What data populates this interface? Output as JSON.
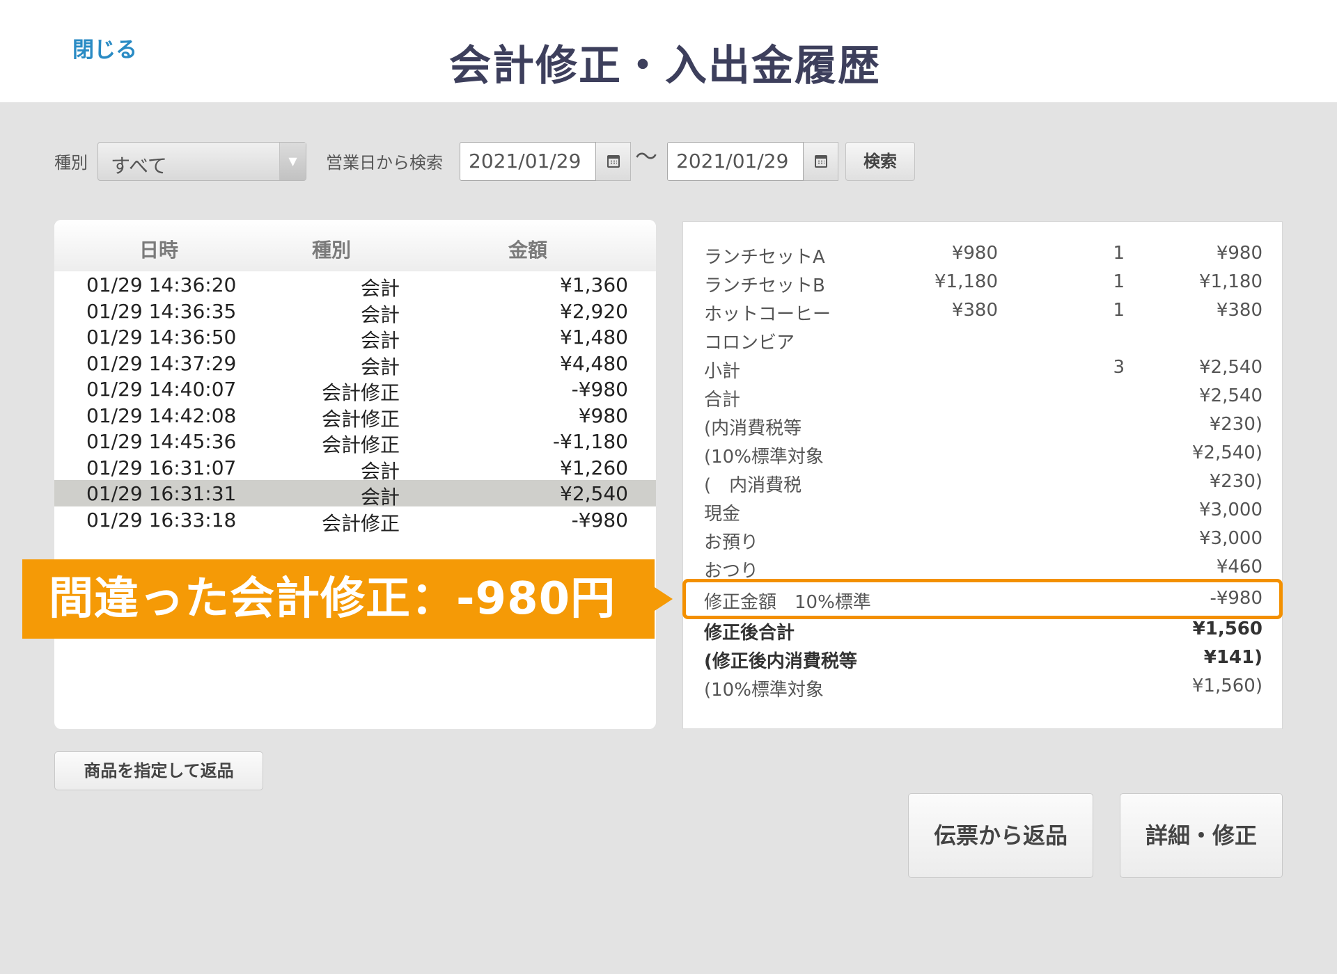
{
  "header": {
    "close_label": "閉じる",
    "title": "会計修正・入出金履歴"
  },
  "filter": {
    "type_label": "種別",
    "type_value": "すべて",
    "date_label": "営業日から検索",
    "date_from": "2021/01/29",
    "tilde": "〜",
    "date_to": "2021/01/29",
    "search_label": "検索"
  },
  "list": {
    "columns": [
      "日時",
      "種別",
      "金額"
    ],
    "rows": [
      {
        "datetime": "01/29 14:36:20",
        "type": "会計",
        "amount": "¥1,360"
      },
      {
        "datetime": "01/29 14:36:35",
        "type": "会計",
        "amount": "¥2,920"
      },
      {
        "datetime": "01/29 14:36:50",
        "type": "会計",
        "amount": "¥1,480"
      },
      {
        "datetime": "01/29 14:37:29",
        "type": "会計",
        "amount": "¥4,480"
      },
      {
        "datetime": "01/29 14:40:07",
        "type": "会計修正",
        "amount": "-¥980"
      },
      {
        "datetime": "01/29 14:42:08",
        "type": "会計修正",
        "amount": "¥980"
      },
      {
        "datetime": "01/29 14:45:36",
        "type": "会計修正",
        "amount": "-¥1,180"
      },
      {
        "datetime": "01/29 16:31:07",
        "type": "会計",
        "amount": "¥1,260"
      },
      {
        "datetime": "01/29 16:31:31",
        "type": "会計",
        "amount": "¥2,540"
      },
      {
        "datetime": "01/29 16:33:18",
        "type": "会計修正",
        "amount": "-¥980"
      }
    ],
    "selected_index": 8
  },
  "detail": {
    "rows": [
      {
        "name": "ランチセットA",
        "price": "¥980",
        "qty": "1",
        "total": "¥980"
      },
      {
        "name": "ランチセットB",
        "price": "¥1,180",
        "qty": "1",
        "total": "¥1,180"
      },
      {
        "name": "ホットコーヒー",
        "price": "¥380",
        "qty": "1",
        "total": "¥380"
      },
      {
        "name": "コロンビア",
        "price": "",
        "qty": "",
        "total": ""
      },
      {
        "name": "小計",
        "price": "",
        "qty": "3",
        "total": "¥2,540"
      },
      {
        "name": "合計",
        "price": "",
        "qty": "",
        "total": "¥2,540"
      },
      {
        "name": "(内消費税等",
        "price": "",
        "qty": "",
        "total": "¥230)"
      },
      {
        "name": "(10%標準対象",
        "price": "",
        "qty": "",
        "total": "¥2,540)"
      },
      {
        "name": "(　内消費税",
        "price": "",
        "qty": "",
        "total": "¥230)"
      },
      {
        "name": "現金",
        "price": "",
        "qty": "",
        "total": "¥3,000"
      },
      {
        "name": "お預り",
        "price": "",
        "qty": "",
        "total": "¥3,000"
      },
      {
        "name": "おつり",
        "price": "",
        "qty": "",
        "total": "¥460"
      },
      {
        "name": "修正金額　10%標準",
        "price": "",
        "qty": "",
        "total": "-¥980"
      },
      {
        "name": "修正後合計",
        "price": "",
        "qty": "",
        "total": "¥1,560",
        "bold": true
      },
      {
        "name": "(修正後内消費税等",
        "price": "",
        "qty": "",
        "total": "¥141)",
        "bold": true
      },
      {
        "name": "(10%標準対象",
        "price": "",
        "qty": "",
        "total": "¥1,560)"
      }
    ]
  },
  "callout": {
    "text": "間違った会計修正：-980円",
    "color": "#f59a06"
  },
  "buttons": {
    "return_by_item": "商品を指定して返品",
    "return_by_slip": "伝票から返品",
    "detail_edit": "詳細・修正"
  }
}
